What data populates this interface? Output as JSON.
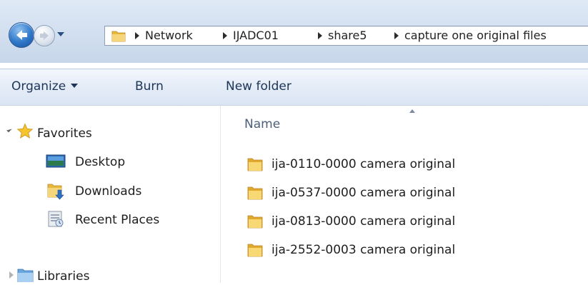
{
  "address": {
    "crumbs": [
      "Network",
      "IJADC01",
      "share5",
      "capture one original files"
    ]
  },
  "toolbar": {
    "organize_label": "Organize",
    "burn_label": "Burn",
    "new_folder_label": "New folder"
  },
  "navpane": {
    "favorites_label": "Favorites",
    "items": [
      {
        "label": "Desktop",
        "icon": "desktop-icon"
      },
      {
        "label": "Downloads",
        "icon": "downloads-icon"
      },
      {
        "label": "Recent Places",
        "icon": "recent-places-icon"
      }
    ],
    "libraries_label": "Libraries"
  },
  "content": {
    "column_header": "Name",
    "files": [
      {
        "name": "ija-0110-0000 camera original",
        "icon": "folder-icon"
      },
      {
        "name": "ija-0537-0000 camera original",
        "icon": "folder-icon"
      },
      {
        "name": "ija-0813-0000 camera original",
        "icon": "folder-icon"
      },
      {
        "name": "ija-2552-0003 camera original",
        "icon": "folder-icon"
      }
    ]
  },
  "colors": {
    "titlebar": "#d2dff0",
    "toolbar_text": "#1d3557",
    "folder_yellow": "#e8b93a",
    "header_text": "#4c607a"
  }
}
